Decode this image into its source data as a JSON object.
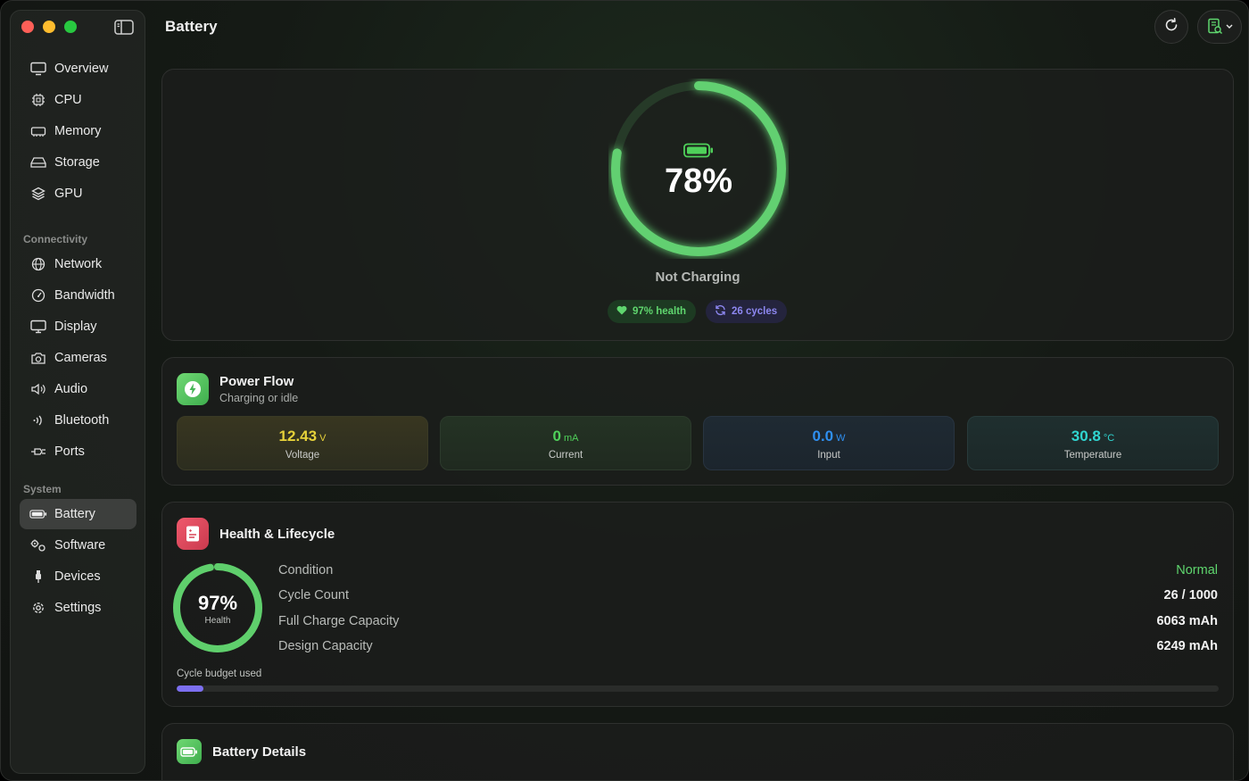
{
  "header": {
    "title": "Battery"
  },
  "sidebar": {
    "items": [
      {
        "label": "Overview"
      },
      {
        "label": "CPU"
      },
      {
        "label": "Memory"
      },
      {
        "label": "Storage"
      },
      {
        "label": "GPU"
      }
    ],
    "connectivity_label": "Connectivity",
    "connectivity": [
      {
        "label": "Network"
      },
      {
        "label": "Bandwidth"
      },
      {
        "label": "Display"
      },
      {
        "label": "Cameras"
      },
      {
        "label": "Audio"
      },
      {
        "label": "Bluetooth"
      },
      {
        "label": "Ports"
      }
    ],
    "system_label": "System",
    "system": [
      {
        "label": "Battery"
      },
      {
        "label": "Software"
      },
      {
        "label": "Devices"
      },
      {
        "label": "Settings"
      }
    ],
    "active": "Battery"
  },
  "hero": {
    "percent_text": "78%",
    "percent_value": 78,
    "status": "Not Charging",
    "health_pill": "97% health",
    "cycles_pill": "26 cycles"
  },
  "power_flow": {
    "title": "Power Flow",
    "subtitle": "Charging or idle",
    "metrics": [
      {
        "value": "12.43",
        "unit": "V",
        "label": "Voltage",
        "color": "#e6d13a"
      },
      {
        "value": "0",
        "unit": "mA",
        "label": "Current",
        "color": "#4fd15a"
      },
      {
        "value": "0.0",
        "unit": "W",
        "label": "Input",
        "color": "#2f8ff0"
      },
      {
        "value": "30.8",
        "unit": "°C",
        "label": "Temperature",
        "color": "#30d5d0"
      }
    ]
  },
  "health": {
    "title": "Health & Lifecycle",
    "gauge_text": "97%",
    "gauge_value": 97,
    "gauge_label": "Health",
    "rows": [
      {
        "label": "Condition",
        "value": "Normal"
      },
      {
        "label": "Cycle Count",
        "value": "26 / 1000"
      },
      {
        "label": "Full Charge Capacity",
        "value": "6063 mAh"
      },
      {
        "label": "Design Capacity",
        "value": "6249 mAh"
      }
    ],
    "budget_label": "Cycle budget used",
    "budget_fraction": 0.026
  },
  "details": {
    "title": "Battery Details"
  },
  "colors": {
    "accent_green": "#5fd66e",
    "accent_purple": "#7c6ff0",
    "condition_normal": "#5fd66e"
  }
}
